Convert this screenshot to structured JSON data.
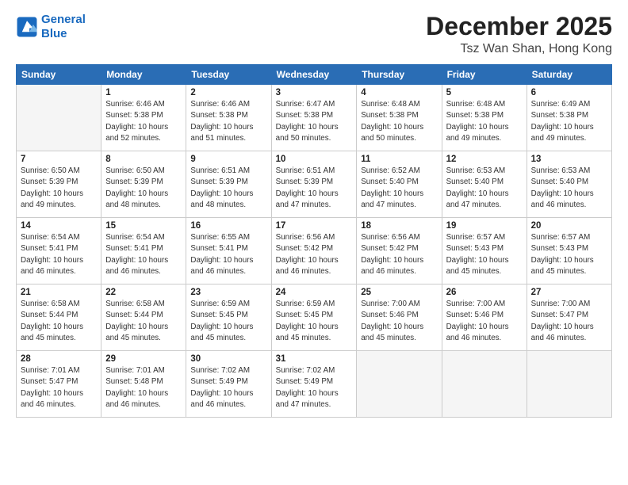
{
  "logo": {
    "line1": "General",
    "line2": "Blue"
  },
  "header": {
    "month": "December 2025",
    "location": "Tsz Wan Shan, Hong Kong"
  },
  "days_of_week": [
    "Sunday",
    "Monday",
    "Tuesday",
    "Wednesday",
    "Thursday",
    "Friday",
    "Saturday"
  ],
  "weeks": [
    [
      {
        "day": "",
        "info": ""
      },
      {
        "day": "1",
        "info": "Sunrise: 6:46 AM\nSunset: 5:38 PM\nDaylight: 10 hours\nand 52 minutes."
      },
      {
        "day": "2",
        "info": "Sunrise: 6:46 AM\nSunset: 5:38 PM\nDaylight: 10 hours\nand 51 minutes."
      },
      {
        "day": "3",
        "info": "Sunrise: 6:47 AM\nSunset: 5:38 PM\nDaylight: 10 hours\nand 50 minutes."
      },
      {
        "day": "4",
        "info": "Sunrise: 6:48 AM\nSunset: 5:38 PM\nDaylight: 10 hours\nand 50 minutes."
      },
      {
        "day": "5",
        "info": "Sunrise: 6:48 AM\nSunset: 5:38 PM\nDaylight: 10 hours\nand 49 minutes."
      },
      {
        "day": "6",
        "info": "Sunrise: 6:49 AM\nSunset: 5:38 PM\nDaylight: 10 hours\nand 49 minutes."
      }
    ],
    [
      {
        "day": "7",
        "info": "Sunrise: 6:50 AM\nSunset: 5:39 PM\nDaylight: 10 hours\nand 49 minutes."
      },
      {
        "day": "8",
        "info": "Sunrise: 6:50 AM\nSunset: 5:39 PM\nDaylight: 10 hours\nand 48 minutes."
      },
      {
        "day": "9",
        "info": "Sunrise: 6:51 AM\nSunset: 5:39 PM\nDaylight: 10 hours\nand 48 minutes."
      },
      {
        "day": "10",
        "info": "Sunrise: 6:51 AM\nSunset: 5:39 PM\nDaylight: 10 hours\nand 47 minutes."
      },
      {
        "day": "11",
        "info": "Sunrise: 6:52 AM\nSunset: 5:40 PM\nDaylight: 10 hours\nand 47 minutes."
      },
      {
        "day": "12",
        "info": "Sunrise: 6:53 AM\nSunset: 5:40 PM\nDaylight: 10 hours\nand 47 minutes."
      },
      {
        "day": "13",
        "info": "Sunrise: 6:53 AM\nSunset: 5:40 PM\nDaylight: 10 hours\nand 46 minutes."
      }
    ],
    [
      {
        "day": "14",
        "info": "Sunrise: 6:54 AM\nSunset: 5:41 PM\nDaylight: 10 hours\nand 46 minutes."
      },
      {
        "day": "15",
        "info": "Sunrise: 6:54 AM\nSunset: 5:41 PM\nDaylight: 10 hours\nand 46 minutes."
      },
      {
        "day": "16",
        "info": "Sunrise: 6:55 AM\nSunset: 5:41 PM\nDaylight: 10 hours\nand 46 minutes."
      },
      {
        "day": "17",
        "info": "Sunrise: 6:56 AM\nSunset: 5:42 PM\nDaylight: 10 hours\nand 46 minutes."
      },
      {
        "day": "18",
        "info": "Sunrise: 6:56 AM\nSunset: 5:42 PM\nDaylight: 10 hours\nand 46 minutes."
      },
      {
        "day": "19",
        "info": "Sunrise: 6:57 AM\nSunset: 5:43 PM\nDaylight: 10 hours\nand 45 minutes."
      },
      {
        "day": "20",
        "info": "Sunrise: 6:57 AM\nSunset: 5:43 PM\nDaylight: 10 hours\nand 45 minutes."
      }
    ],
    [
      {
        "day": "21",
        "info": "Sunrise: 6:58 AM\nSunset: 5:44 PM\nDaylight: 10 hours\nand 45 minutes."
      },
      {
        "day": "22",
        "info": "Sunrise: 6:58 AM\nSunset: 5:44 PM\nDaylight: 10 hours\nand 45 minutes."
      },
      {
        "day": "23",
        "info": "Sunrise: 6:59 AM\nSunset: 5:45 PM\nDaylight: 10 hours\nand 45 minutes."
      },
      {
        "day": "24",
        "info": "Sunrise: 6:59 AM\nSunset: 5:45 PM\nDaylight: 10 hours\nand 45 minutes."
      },
      {
        "day": "25",
        "info": "Sunrise: 7:00 AM\nSunset: 5:46 PM\nDaylight: 10 hours\nand 45 minutes."
      },
      {
        "day": "26",
        "info": "Sunrise: 7:00 AM\nSunset: 5:46 PM\nDaylight: 10 hours\nand 46 minutes."
      },
      {
        "day": "27",
        "info": "Sunrise: 7:00 AM\nSunset: 5:47 PM\nDaylight: 10 hours\nand 46 minutes."
      }
    ],
    [
      {
        "day": "28",
        "info": "Sunrise: 7:01 AM\nSunset: 5:47 PM\nDaylight: 10 hours\nand 46 minutes."
      },
      {
        "day": "29",
        "info": "Sunrise: 7:01 AM\nSunset: 5:48 PM\nDaylight: 10 hours\nand 46 minutes."
      },
      {
        "day": "30",
        "info": "Sunrise: 7:02 AM\nSunset: 5:49 PM\nDaylight: 10 hours\nand 46 minutes."
      },
      {
        "day": "31",
        "info": "Sunrise: 7:02 AM\nSunset: 5:49 PM\nDaylight: 10 hours\nand 47 minutes."
      },
      {
        "day": "",
        "info": ""
      },
      {
        "day": "",
        "info": ""
      },
      {
        "day": "",
        "info": ""
      }
    ]
  ]
}
